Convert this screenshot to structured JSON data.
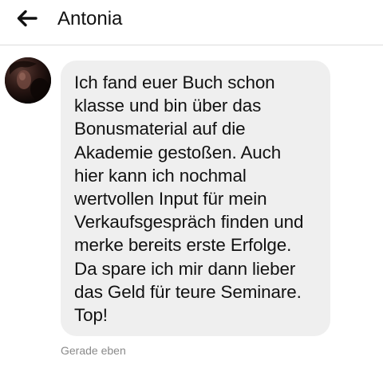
{
  "header": {
    "back_icon": "arrow-left-icon",
    "title": "Antonia"
  },
  "message": {
    "text": "Ich fand euer Buch schon\nklasse und bin über das\nBonusmaterial auf die\nAkademie gestoßen. Auch\nhier kann ich nochmal\nwertvollen Input für mein\nVerkaufsgespräch finden und\nmerke bereits erste Erfolge.\nDa spare ich mir dann lieber\ndas Geld für teure Seminare.\nTop!",
    "timestamp": "Gerade eben",
    "bubble_color": "#efefef"
  }
}
